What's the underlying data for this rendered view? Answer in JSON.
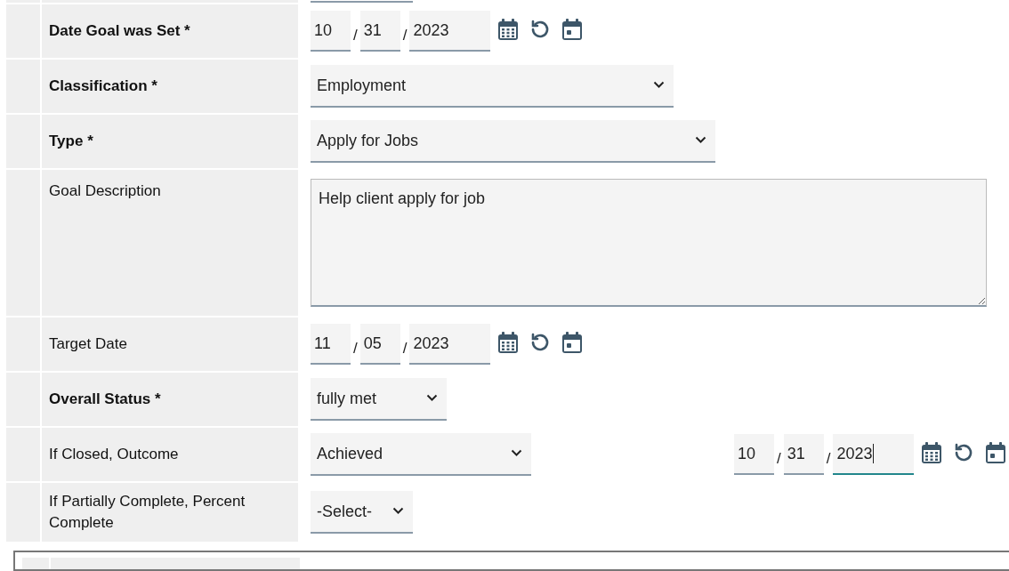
{
  "rows": [
    {
      "label": "Date Goal was Set *",
      "bold": true,
      "field": {
        "kind": "date",
        "parts": [
          {
            "value": "10",
            "focused": false
          },
          {
            "value": "31",
            "focused": false
          },
          {
            "value": "2023",
            "focused": false
          }
        ],
        "separators": [
          "/",
          "/"
        ]
      }
    },
    {
      "label": "Classification *",
      "bold": true,
      "field": {
        "kind": "select",
        "value": "Employment"
      }
    },
    {
      "label": "Type *",
      "bold": true,
      "field": {
        "kind": "select",
        "value": "Apply for Jobs"
      }
    },
    {
      "label": "Goal Description",
      "bold": false,
      "field": {
        "kind": "textarea",
        "value": "Help client apply for job"
      }
    },
    {
      "label": "Target Date",
      "bold": false,
      "field": {
        "kind": "date",
        "parts": [
          {
            "value": "11",
            "focused": false
          },
          {
            "value": "05",
            "focused": false
          },
          {
            "value": "2023",
            "focused": false
          }
        ],
        "separators": [
          "/",
          "/"
        ]
      }
    },
    {
      "label": "Overall Status *",
      "bold": true,
      "field": {
        "kind": "select",
        "value": "fully met"
      }
    },
    {
      "label": "If Closed, Outcome",
      "bold": false,
      "field": {
        "kind": "select",
        "value": "Achieved"
      },
      "extra": {
        "kind": "date",
        "parts": [
          {
            "value": "10",
            "focused": false
          },
          {
            "value": "31",
            "focused": false
          },
          {
            "value": "2023",
            "focused": true
          }
        ],
        "separators": [
          "/",
          "/"
        ]
      }
    },
    {
      "label": "If Partially Complete, Percent Complete",
      "bold": false,
      "field": {
        "kind": "select",
        "value": "-Select-"
      }
    }
  ]
}
